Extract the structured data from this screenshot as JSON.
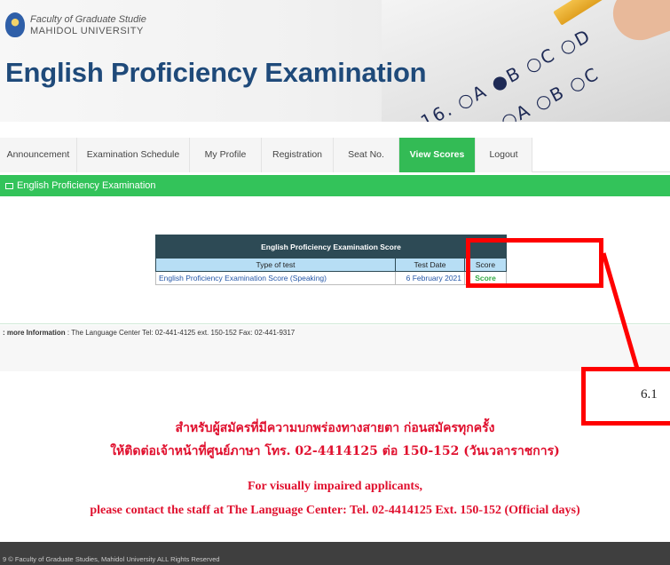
{
  "header": {
    "faculty": "Faculty of Graduate Studie",
    "university": "MAHIDOL UNIVERSITY",
    "title": "English Proficiency Examination"
  },
  "nav": {
    "items": [
      {
        "label": "Announcement"
      },
      {
        "label": "Examination Schedule"
      },
      {
        "label": "My Profile"
      },
      {
        "label": "Registration"
      },
      {
        "label": "Seat No."
      },
      {
        "label": "View Scores",
        "active": true
      },
      {
        "label": "Logout"
      }
    ]
  },
  "section": {
    "title": "English Proficiency Examination"
  },
  "score_table": {
    "caption": "English Proficiency Examination Score",
    "headers": [
      "Type of test",
      "Test Date",
      "Score"
    ],
    "rows": [
      {
        "type": "English Proficiency Examination Score (Speaking)",
        "date": "6 February 2021",
        "score": "Score"
      }
    ]
  },
  "info": {
    "label": ": more Information",
    "text": ": The Language Center Tel: 02-441-4125 ext. 150-152 Fax: 02-441-9317"
  },
  "annotation": {
    "label": "6.1",
    "color": "#ff0000"
  },
  "notice": {
    "thai_line1": "สำหรับผู้สมัครที่มีความบกพร่องทางสายตา ก่อนสมัครทุกครั้ง",
    "thai_line2": "ให้ติดต่อเจ้าหน้าที่ศูนย์ภาษา โทร. 02-4414125 ต่อ 150-152 (วันเวลาราชการ)",
    "en_line1": "For visually impaired applicants,",
    "en_line2": "please contact the staff at The Language Center: Tel. 02-4414125 Ext. 150-152 (Official days)"
  },
  "footer": {
    "text": "9 © Faculty of Graduate Studies, Mahidol University ALL Rights Reserved"
  },
  "colors": {
    "accent_green": "#33c35a",
    "title_blue": "#1f4a7a",
    "notice_red": "#e0102e",
    "table_header": "#2d4a55"
  }
}
